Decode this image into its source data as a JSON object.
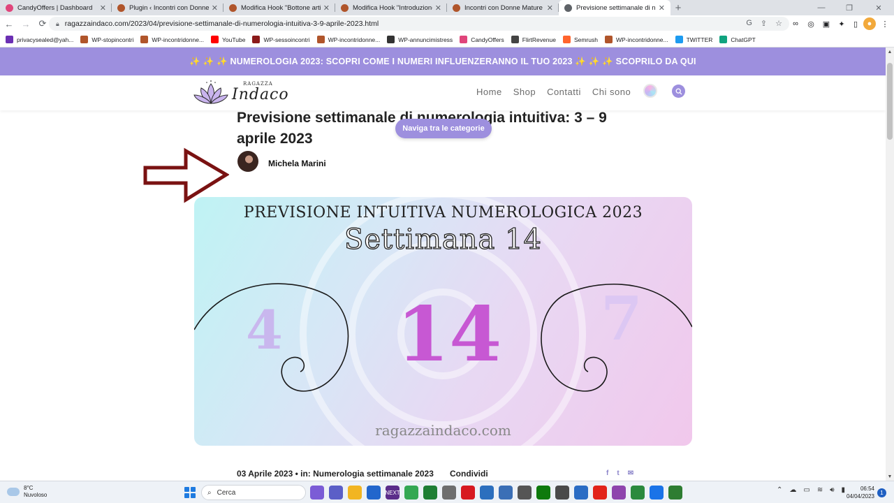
{
  "browser": {
    "tabs": [
      {
        "label": "CandyOffers | Dashboard",
        "color": "#e0457b"
      },
      {
        "label": "Plugin ‹ Incontri con Donne Mature",
        "color": "#b0552b"
      },
      {
        "label": "Modifica Hook \"Bottone articoli",
        "color": "#b0552b"
      },
      {
        "label": "Modifica Hook \"Introduzione Ho",
        "color": "#b0552b"
      },
      {
        "label": "Incontri con Donne Mature Coug",
        "color": "#b0552b"
      },
      {
        "label": "Previsione settimanale di numer",
        "color": "#5f6368"
      }
    ],
    "new_tab": "+",
    "url": "ragazzaindaco.com/2023/04/previsione-settimanale-di-numerologia-intuitiva-3-9-aprile-2023.html",
    "bookmarks": [
      {
        "label": "privacysealed@yah...",
        "color": "#6b2fb3"
      },
      {
        "label": "WP-stopincontri",
        "color": "#b0552b"
      },
      {
        "label": "WP-incontridonne...",
        "color": "#b0552b"
      },
      {
        "label": "YouTube",
        "color": "#ff0000"
      },
      {
        "label": "WP-sessoincontri",
        "color": "#8b1a1a"
      },
      {
        "label": "WP-incontridonne...",
        "color": "#b0552b"
      },
      {
        "label": "WP-annuncimistress",
        "color": "#333333"
      },
      {
        "label": "CandyOffers",
        "color": "#e0457b"
      },
      {
        "label": "FlirtRevenue",
        "color": "#444444"
      },
      {
        "label": "Semrush",
        "color": "#ff642d"
      },
      {
        "label": "WP-incontridonne...",
        "color": "#b0552b"
      },
      {
        "label": "TWITTER",
        "color": "#1d9bf0"
      },
      {
        "label": "ChatGPT",
        "color": "#10a37f"
      }
    ]
  },
  "page": {
    "promo": "✨ ✨ ✨ NUMEROLOGIA 2023: SCOPRI COME I NUMERI INFLUENZERANNO IL TUO 2023 ✨ ✨ ✨ SCOPRILO DA QUI",
    "logo_small": "RAGAZZA",
    "logo_big": "Indaco",
    "nav": [
      "Home",
      "Shop",
      "Contatti",
      "Chi sono"
    ],
    "title": "Previsione settimanale di numerologia intuitiva: 3 – 9 aprile 2023",
    "category_pill": "Naviga tra le categorie",
    "author": "Michela Marini",
    "hero": {
      "heading": "PREVISIONE INTUITIVA NUMEROLOGICA 2023",
      "week": "Settimana 14",
      "numbers": [
        "4",
        "14",
        "7"
      ],
      "site": "ragazzaindaco.com"
    },
    "meta": "03 Aprile 2023 • in: Numerologia settimanale 2023",
    "share_label": "Condividi",
    "share_icons": [
      "f",
      "t",
      "✉"
    ],
    "accent": "#9d8fde"
  },
  "taskbar": {
    "temp": "8°C",
    "weather": "Nuvoloso",
    "search": "Cerca",
    "time": "06:54",
    "date": "04/04/2023",
    "notifications": "1",
    "apps": [
      {
        "color": "#7b5cd6"
      },
      {
        "color": "#5b5fc7"
      },
      {
        "color": "#f2b522"
      },
      {
        "color": "#2266cc"
      },
      {
        "color": "#5b2d8a",
        "label": "NEXT"
      },
      {
        "color": "#34a853"
      },
      {
        "color": "#1e7e34"
      },
      {
        "color": "#6e6e6e"
      },
      {
        "color": "#d71920"
      },
      {
        "color": "#2c6fbe"
      },
      {
        "color": "#3b6fb6"
      },
      {
        "color": "#555555"
      },
      {
        "color": "#0e7a0d"
      },
      {
        "color": "#4a4a4a"
      },
      {
        "color": "#2a6cc4"
      },
      {
        "color": "#e2231a"
      },
      {
        "color": "#8e44ad"
      },
      {
        "color": "#2b8a3e"
      },
      {
        "color": "#1a73e8"
      },
      {
        "color": "#2e7d32"
      }
    ]
  }
}
